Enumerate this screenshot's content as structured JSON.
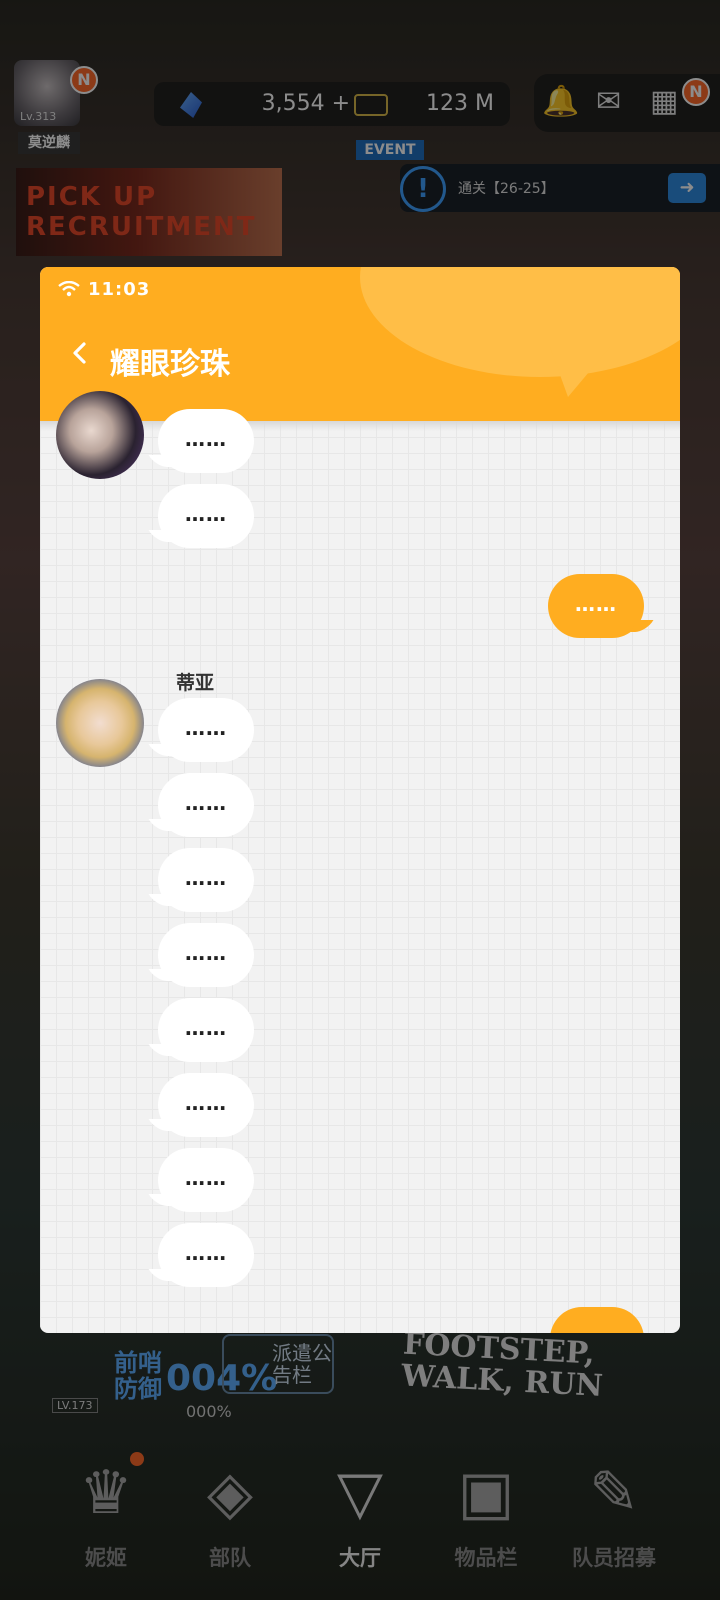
{
  "hub": {
    "player_level": "Lv.313",
    "player_name": "莫逆麟",
    "new_badge": "N",
    "gems": "3,554",
    "gem_add": "+",
    "credits": "123 M",
    "banner_text": "PICK UP RECRUITMENT",
    "event_tag": "EVENT",
    "event_alert": "!",
    "event_stage": "通关【26-25】",
    "outpost_level": "LV.173",
    "outpost_label": "前哨防御",
    "outpost_percent": "004%",
    "outpost_sub_percent": "000%",
    "notice_board": "派遣公告栏",
    "footstep_text": "FOOTSTEP, WALK, RUN"
  },
  "nav": {
    "items": [
      {
        "label": "妮姬",
        "icon": "nikke-icon"
      },
      {
        "label": "部队",
        "icon": "squad-icon"
      },
      {
        "label": "大厅",
        "icon": "lobby-icon"
      },
      {
        "label": "物品栏",
        "icon": "inventory-icon"
      },
      {
        "label": "队员招募",
        "icon": "recruit-icon"
      }
    ],
    "active": "大厅"
  },
  "chat": {
    "time": "11:03",
    "title": "耀眼珍珠",
    "sender_name": "蒂亚",
    "message_text": "……"
  }
}
